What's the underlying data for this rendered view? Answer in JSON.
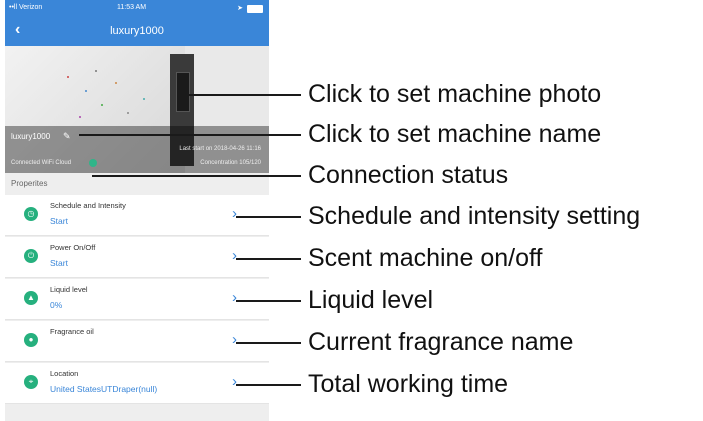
{
  "status_bar": {
    "carrier": "••ll Verizon",
    "time": "11:53 AM"
  },
  "nav": {
    "back_icon": "chevron-left-icon",
    "title": "luxury1000"
  },
  "machine": {
    "name": "luxury1000",
    "last_start": "Last start on 2018-04-26 11:16",
    "connection_label": "Connected WiFi Cloud",
    "concentration": "Concentration 105/120"
  },
  "section_title": "Properites",
  "properties": [
    {
      "label": "Schedule and Intensity",
      "value": "Start",
      "icon": "clock-icon"
    },
    {
      "label": "Power On/Off",
      "value": "Start",
      "icon": "power-icon"
    },
    {
      "label": "Liquid level",
      "value": "0%",
      "icon": "liquid-icon"
    },
    {
      "label": "Fragrance oil",
      "value": "",
      "icon": "fragrance-icon"
    },
    {
      "label": "Location",
      "value": "United StatesUTDraper(null)",
      "icon": "location-pin-icon"
    }
  ],
  "callouts": [
    "Click to set machine photo",
    "Click to set machine name",
    "Connection status",
    "Schedule and intensity setting",
    "Scent machine on/off",
    "Liquid level",
    "Current fragrance name",
    "Total working time"
  ],
  "colors": {
    "header_blue": "#3a86d8",
    "icon_green": "#26b07e",
    "value_blue": "#3a86d8"
  }
}
